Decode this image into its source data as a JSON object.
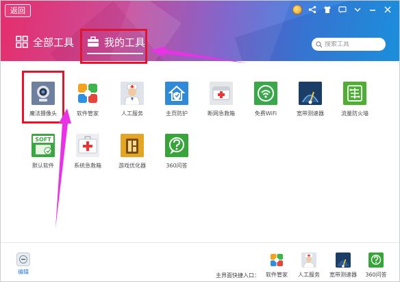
{
  "header": {
    "back_label": "返回",
    "tabs": [
      {
        "label": "全部工具",
        "icon": "grid-icon",
        "selected": false
      },
      {
        "label": "我的工具",
        "icon": "toolbox-icon",
        "selected": true
      }
    ],
    "search_placeholder": "搜索工具"
  },
  "tools": [
    {
      "label": "魔法摄像头",
      "icon": "webcam-icon"
    },
    {
      "label": "软件管家",
      "icon": "software-manager-icon"
    },
    {
      "label": "人工服务",
      "icon": "doctor-icon"
    },
    {
      "label": "主页防护",
      "icon": "home-shield-icon"
    },
    {
      "label": "断网急救箱",
      "icon": "first-aid-network-icon"
    },
    {
      "label": "免费WiFi",
      "icon": "wifi-icon"
    },
    {
      "label": "宽带测速器",
      "icon": "speedometer-icon"
    },
    {
      "label": "流量防火墙",
      "icon": "firewall-icon"
    },
    {
      "label": "默认软件",
      "icon": "soft-default-icon",
      "badge": "SOFT"
    },
    {
      "label": "系统急救箱",
      "icon": "first-aid-kit-icon"
    },
    {
      "label": "游戏优化器",
      "icon": "game-optimizer-icon"
    },
    {
      "label": "360问答",
      "icon": "question-icon"
    }
  ],
  "footer": {
    "edit_label": "编辑",
    "quick_entry_label": "主界面快捷入口：",
    "quick_items": [
      {
        "label": "软件管家",
        "icon": "software-manager-icon"
      },
      {
        "label": "人工服务",
        "icon": "doctor-icon"
      },
      {
        "label": "宽带测速器",
        "icon": "speedometer-icon"
      },
      {
        "label": "360问答",
        "icon": "question-icon"
      }
    ]
  },
  "colors": {
    "highlight": "#e1142b",
    "arrow": "#e832e6",
    "link": "#2a7fd4"
  }
}
